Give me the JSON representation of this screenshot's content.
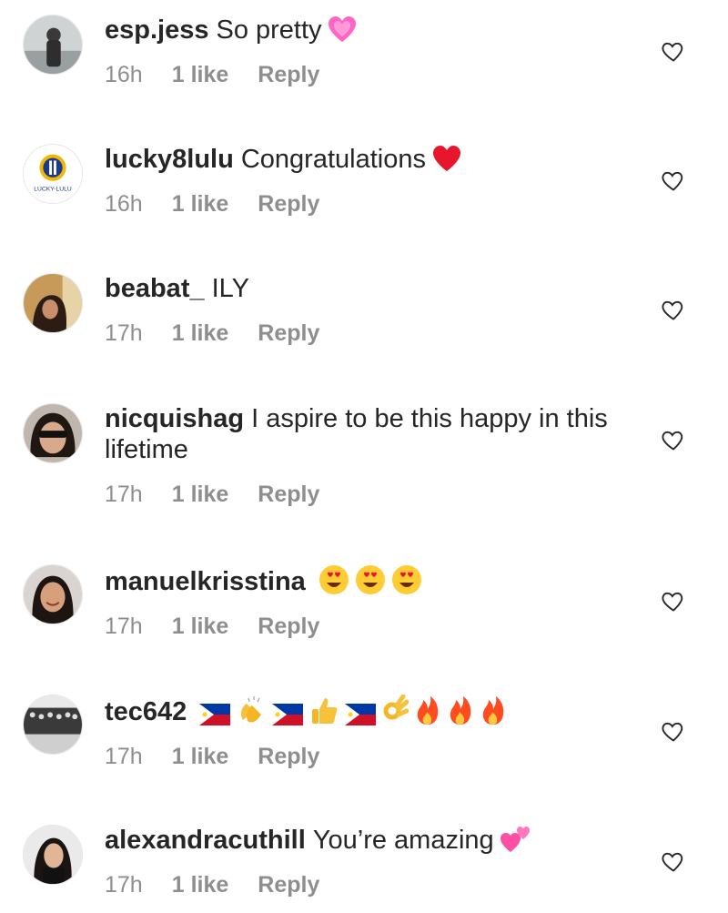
{
  "comments": [
    {
      "username": "esp.jess",
      "text": "So pretty",
      "emojis": [
        "pulsing-heart"
      ],
      "time": "16h",
      "likes": "1 like",
      "reply": "Reply",
      "avatar": "photo-man-standing"
    },
    {
      "username": "lucky8lulu",
      "text": "Congratulations",
      "emojis": [
        "red-heart"
      ],
      "time": "16h",
      "likes": "1 like",
      "reply": "Reply",
      "avatar": "logo-lucky-lulu",
      "avatar_text": "LUCKY-LULU"
    },
    {
      "username": "beabat_",
      "text": "ILY",
      "emojis": [],
      "time": "17h",
      "likes": "1 like",
      "reply": "Reply",
      "avatar": "photo-woman-long-hair"
    },
    {
      "username": "nicquishag",
      "text": "I aspire to be this happy in this lifetime",
      "emojis": [],
      "time": "17h",
      "likes": "1 like",
      "reply": "Reply",
      "avatar": "photo-woman-sunglasses"
    },
    {
      "username": "manuelkrisstina",
      "text": "",
      "emojis": [
        "heart-eyes",
        "heart-eyes",
        "heart-eyes"
      ],
      "time": "17h",
      "likes": "1 like",
      "reply": "Reply",
      "avatar": "photo-woman-smiling"
    },
    {
      "username": "tec642",
      "text": "",
      "emojis": [
        "flag-ph",
        "clapping-hands",
        "flag-ph",
        "thumbs-up",
        "flag-ph",
        "ok-hand",
        "fire",
        "fire",
        "fire"
      ],
      "time": "17h",
      "likes": "1 like",
      "reply": "Reply",
      "avatar": "photo-group-bw"
    },
    {
      "username": "alexandracuthill",
      "text": "You’re amazing",
      "emojis": [
        "two-hearts"
      ],
      "time": "17h",
      "likes": "1 like",
      "reply": "Reply",
      "avatar": "photo-woman-dark-hair"
    }
  ],
  "colors": {
    "text": "#262626",
    "meta": "#8e8e8e",
    "border": "#e6e6e6"
  }
}
